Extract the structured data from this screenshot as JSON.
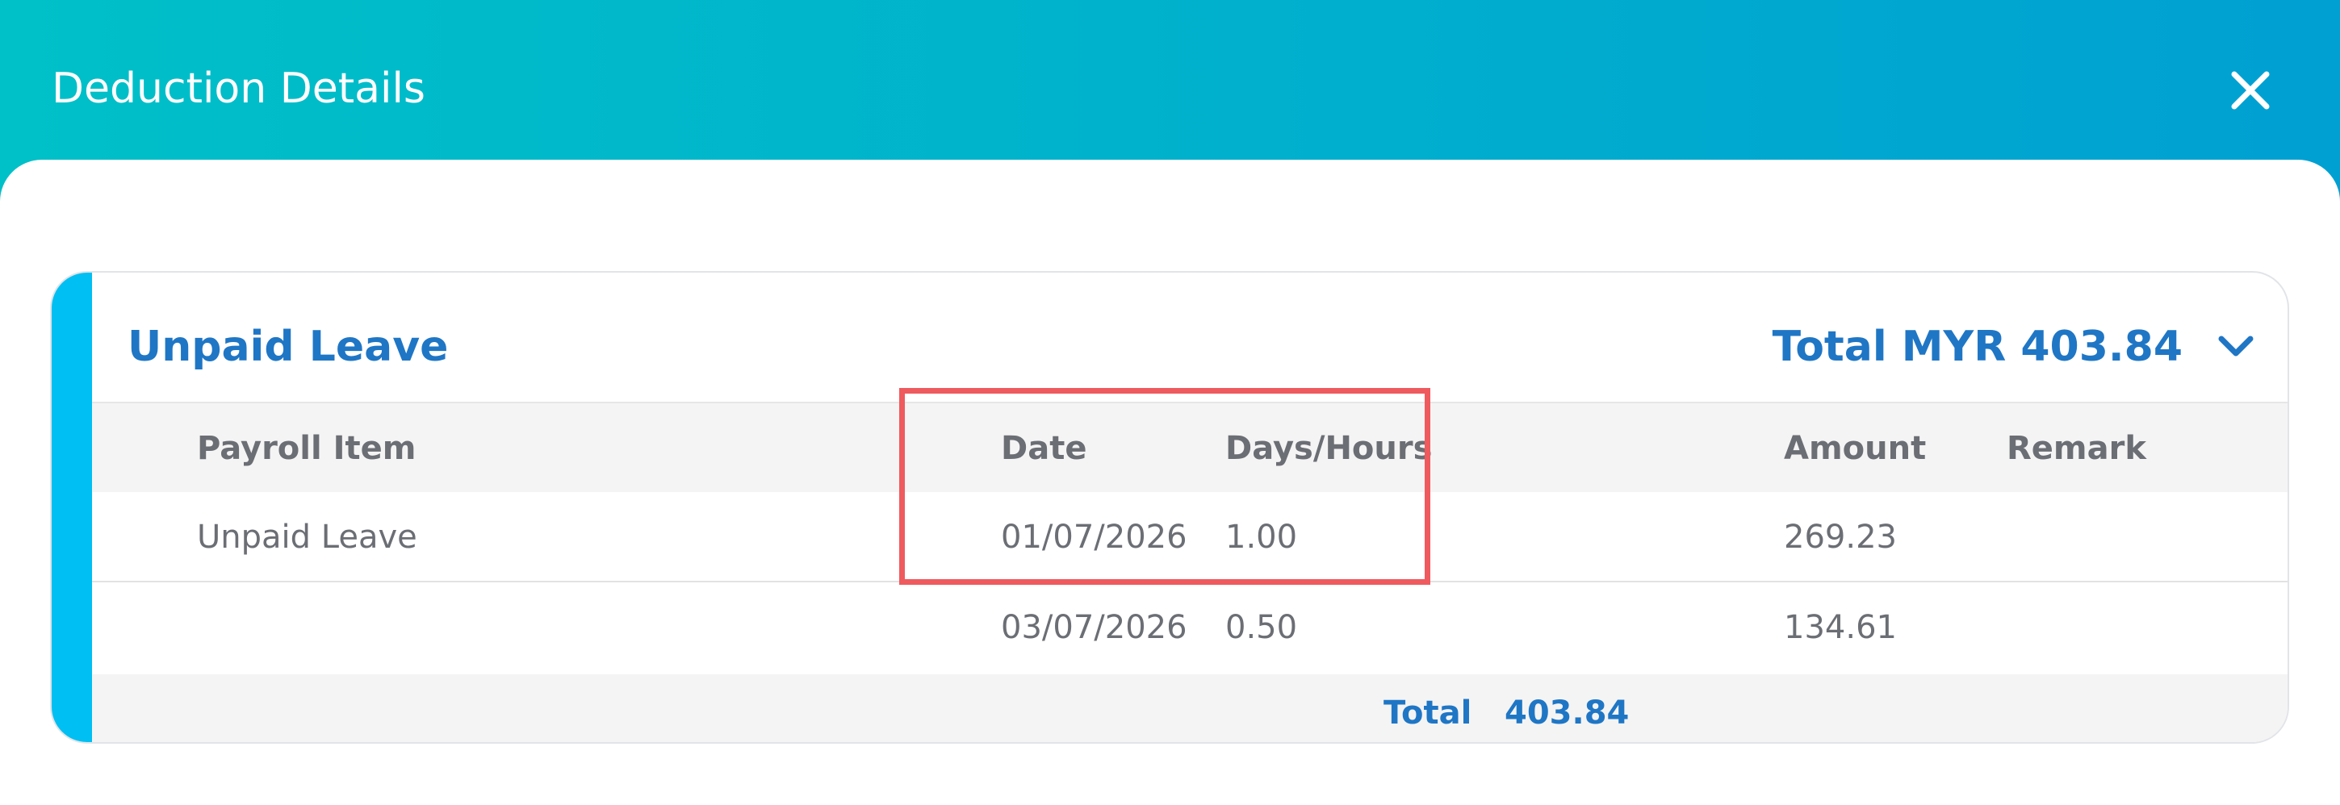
{
  "modal": {
    "title": "Deduction Details",
    "close_icon": "close-icon"
  },
  "card": {
    "title": "Unpaid Leave",
    "total_label": "Total MYR 403.84",
    "chevron_icon": "chevron-down-icon"
  },
  "table": {
    "columns": [
      "Payroll Item",
      "Date",
      "Days/Hours",
      "Amount",
      "Remark"
    ],
    "rows": [
      {
        "payroll_item": "Unpaid Leave",
        "date": "01/07/2026",
        "days_hours": "1.00",
        "amount": "269.23",
        "remark": ""
      },
      {
        "payroll_item": "",
        "date": "03/07/2026",
        "days_hours": "0.50",
        "amount": "134.61",
        "remark": ""
      }
    ],
    "total_label": "Total",
    "total_value": "403.84"
  },
  "colors": {
    "header_gradient_start": "#00c0c8",
    "header_gradient_end": "#00a0d2",
    "accent_bar": "#00bff2",
    "primary_text": "#1f76c5",
    "highlight_border": "#ee5a5e"
  }
}
